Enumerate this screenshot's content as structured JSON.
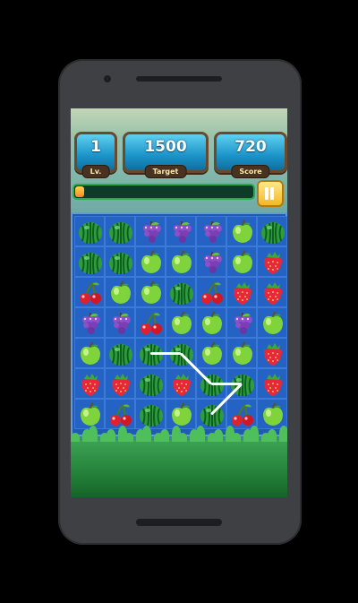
{
  "hud": {
    "level": {
      "value": "1",
      "label": "Lv."
    },
    "target": {
      "value": "1500",
      "label": "Target"
    },
    "score": {
      "value": "720",
      "label": "Score"
    }
  },
  "progress": {
    "fraction": 0.05
  },
  "board": {
    "cols": 7,
    "rows": 7,
    "grid": [
      [
        "watermelon",
        "watermelon",
        "grape",
        "grape",
        "grape",
        "apple",
        "watermelon"
      ],
      [
        "watermelon",
        "watermelon",
        "apple",
        "apple",
        "grape",
        "apple",
        "strawberry"
      ],
      [
        "cherry",
        "apple",
        "apple",
        "watermelon",
        "cherry",
        "strawberry",
        "strawberry"
      ],
      [
        "grape",
        "grape",
        "cherry",
        "apple",
        "apple",
        "grape",
        "apple"
      ],
      [
        "apple",
        "watermelon",
        "watermelon",
        "watermelon",
        "apple",
        "apple",
        "strawberry"
      ],
      [
        "strawberry",
        "strawberry",
        "watermelon",
        "strawberry",
        "watermelon",
        "watermelon",
        "strawberry"
      ],
      [
        "apple",
        "cherry",
        "watermelon",
        "apple",
        "watermelon",
        "cherry",
        "apple"
      ]
    ],
    "selected_path": [
      [
        4,
        2
      ],
      [
        4,
        3
      ],
      [
        5,
        4
      ],
      [
        5,
        5
      ],
      [
        6,
        4
      ]
    ]
  }
}
